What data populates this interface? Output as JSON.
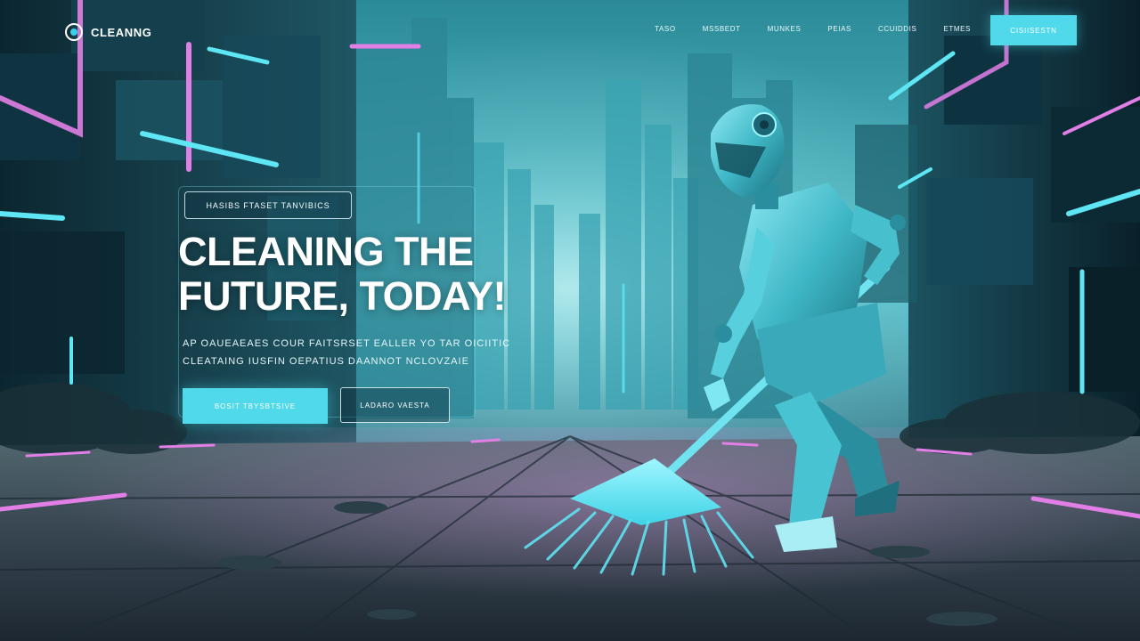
{
  "brand": {
    "name": "CLEANNG",
    "logo_icon": "ring-logo-icon"
  },
  "nav": {
    "items": [
      "TASO",
      "MSSBEDT",
      "MUNKES",
      "PEIAS",
      "CCUIDDIS",
      "ETMES"
    ],
    "cta_label": "CISIISESTN"
  },
  "hero": {
    "tag": "HASIBS FTASET TANVIBICS",
    "title_line1": "CLEANING THE",
    "title_line2": "FUTURE, TODAY!",
    "subtitle_line1": "AP OAUEAEAES COUR FAITSRSET EALLER YO TAR OICIITIC",
    "subtitle_line2": "CLEATAING IUSFIN OEPATIUS DAANNOT NCLOVZAIE",
    "primary_button": "BOSIT TBYSBTSIVE",
    "secondary_button": "LADARO VAESTA"
  },
  "colors": {
    "accent": "#4fd9ea",
    "neon_pink": "#e27fe6",
    "background": "#0d2a36"
  }
}
